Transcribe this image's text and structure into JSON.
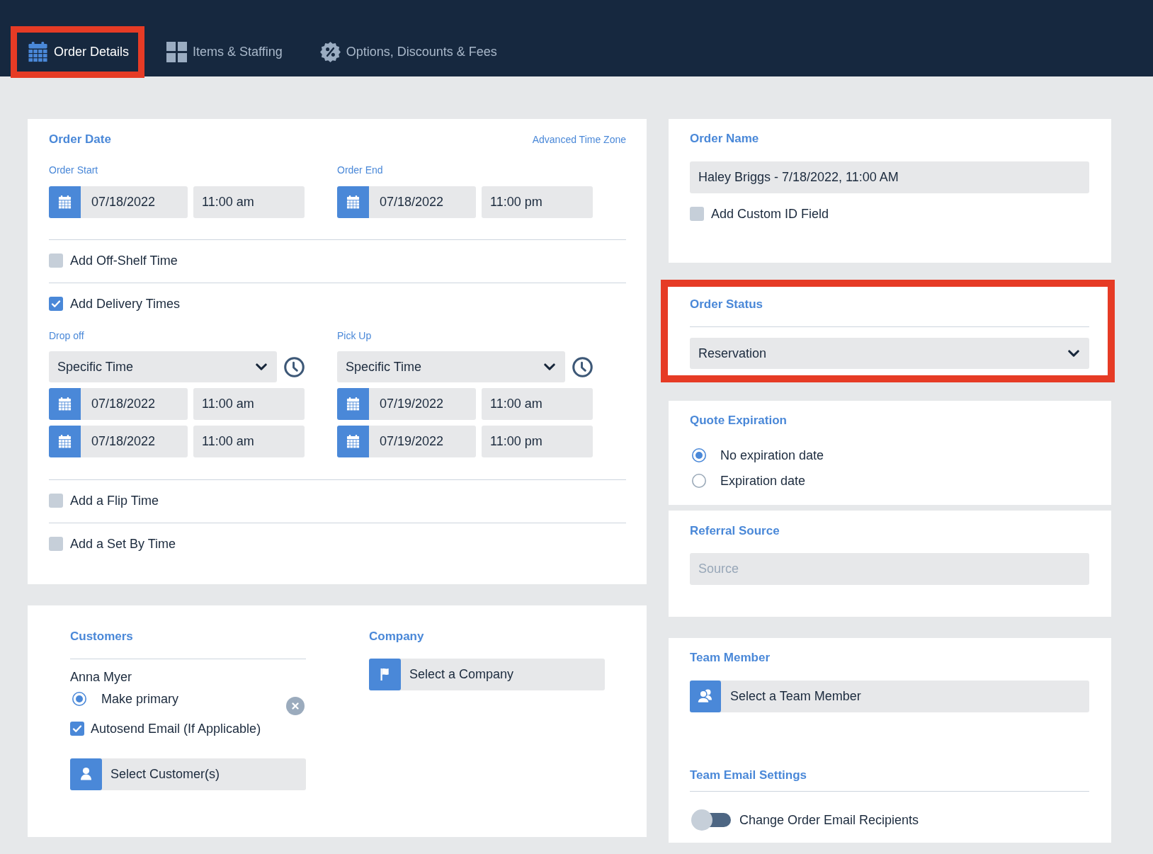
{
  "nav": {
    "tabs": [
      {
        "label": "Order Details",
        "selected": true,
        "highlighted": true
      },
      {
        "label": "Items & Staffing",
        "selected": false,
        "highlighted": false
      },
      {
        "label": "Options, Discounts & Fees",
        "selected": false,
        "highlighted": false
      }
    ]
  },
  "order_date": {
    "title": "Order Date",
    "link": "Advanced Time Zone",
    "ranges": [
      {
        "label": "Order Start",
        "date": "07/18/2022",
        "time": "11:00 am"
      },
      {
        "label": "Order End",
        "date": "07/18/2022",
        "time": "11:00 pm"
      }
    ],
    "off_shelf": {
      "label": "Add Off-Shelf Time",
      "checked": false
    },
    "delivery": {
      "label": "Add Delivery Times",
      "checked": true,
      "legs": [
        {
          "label": "Drop off",
          "mode": "Specific Time",
          "slots": [
            {
              "date": "07/18/2022",
              "time": "11:00 am"
            },
            {
              "date": "07/18/2022",
              "time": "11:00 am"
            }
          ]
        },
        {
          "label": "Pick Up",
          "mode": "Specific Time",
          "slots": [
            {
              "date": "07/19/2022",
              "time": "11:00 am"
            },
            {
              "date": "07/19/2022",
              "time": "11:00 pm"
            }
          ]
        }
      ]
    },
    "flip": {
      "label": "Add a Flip Time",
      "checked": false
    },
    "set_by": {
      "label": "Add a Set By Time",
      "checked": false
    }
  },
  "customers": {
    "title": "Customers",
    "entries": [
      {
        "name": "Anna Myer",
        "primary_label": "Make primary",
        "primary": true,
        "autosend_label": "Autosend Email (If Applicable)",
        "autosend": true
      }
    ],
    "button": "Select Customer(s)"
  },
  "company": {
    "title": "Company",
    "button": "Select a Company"
  },
  "order_name": {
    "title": "Order Name",
    "value": "Haley Briggs - 7/18/2022, 11:00 AM",
    "custom_id": {
      "label": "Add Custom ID Field",
      "checked": false
    }
  },
  "order_status": {
    "title": "Order Status",
    "value": "Reservation",
    "highlighted": true
  },
  "quote_expiration": {
    "title": "Quote Expiration",
    "options": [
      {
        "label": "No expiration date",
        "selected": true
      },
      {
        "label": "Expiration date",
        "selected": false
      }
    ]
  },
  "referral_source": {
    "title": "Referral Source",
    "placeholder": "Source"
  },
  "team_member": {
    "title": "Team Member",
    "button": "Select a Team Member"
  },
  "team_email_settings": {
    "title": "Team Email Settings",
    "toggle": {
      "label": "Change Order Email Recipients",
      "on": false
    }
  }
}
